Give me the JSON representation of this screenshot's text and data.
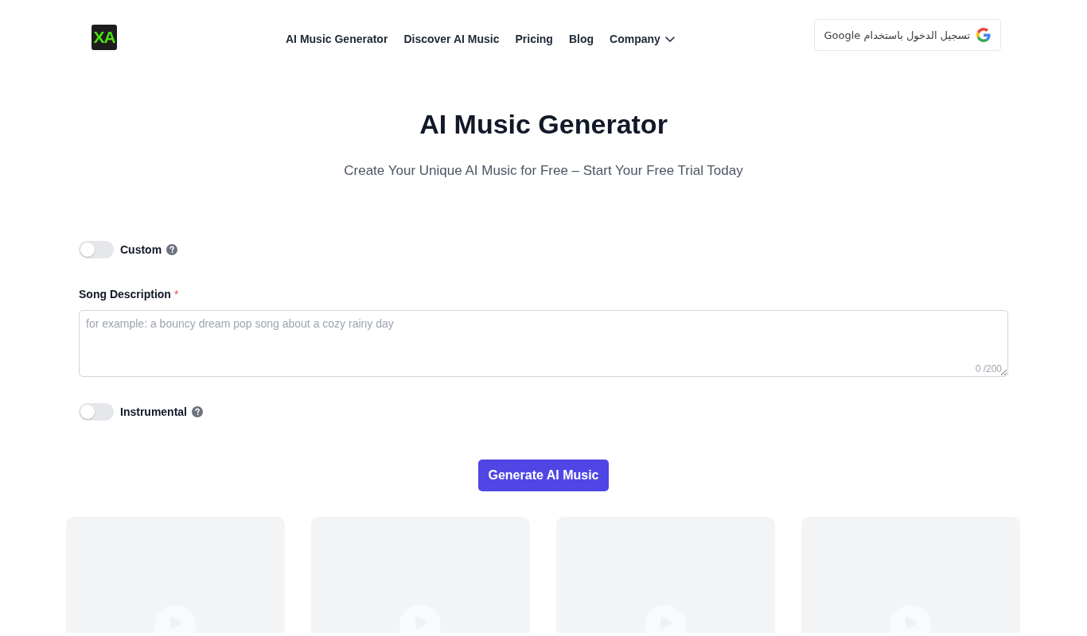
{
  "header": {
    "logo": {
      "text": "XA"
    },
    "nav": [
      {
        "label": "AI Music Generator",
        "kind": "link"
      },
      {
        "label": "Discover AI Music",
        "kind": "link"
      },
      {
        "label": "Pricing",
        "kind": "link"
      },
      {
        "label": "Blog",
        "kind": "link"
      },
      {
        "label": "Company",
        "kind": "dropdown"
      }
    ],
    "sign_in_button": "تسجيل الدخول باستخدام Google"
  },
  "hero": {
    "title": "AI Music Generator",
    "subtitle": "Create Your Unique AI Music for Free – Start Your Free Trial Today"
  },
  "form": {
    "custom_toggle": {
      "label": "Custom",
      "on": false
    },
    "song_description": {
      "label": "Song Description",
      "required_mark": "*",
      "placeholder": "for example: a bouncy dream pop song about a cozy rainy day",
      "counter": "0 /200"
    },
    "instrumental_toggle": {
      "label": "Instrumental",
      "on": false
    },
    "generate_button": "Generate AI Music"
  },
  "media_cards": [
    {
      "kind": "audio_placeholder"
    },
    {
      "kind": "audio_placeholder"
    },
    {
      "kind": "audio_placeholder"
    },
    {
      "kind": "audio_placeholder"
    }
  ]
}
